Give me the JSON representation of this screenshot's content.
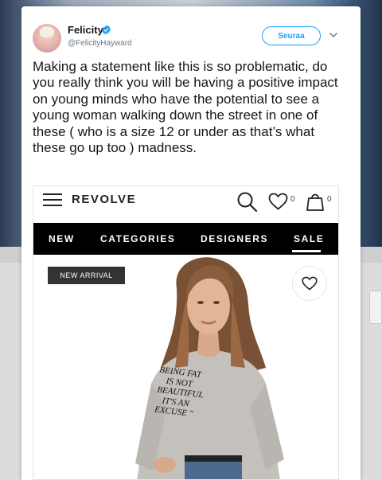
{
  "tweet": {
    "author_name": "Felicity",
    "handle": "@FelicityHayward",
    "follow_label": "Seuraa",
    "text": "Making a statement like this is so problematic, do you really think you will be having a positive impact on young minds who have the potential to see a young woman walking down the street in one of these ( who is a size 12 or under as that’s what these go up too ) madness."
  },
  "embedded": {
    "logo": "REVOLVE",
    "wishlist_count": "0",
    "bag_count": "0",
    "nav": [
      "NEW",
      "CATEGORIES",
      "DESIGNERS",
      "SALE"
    ],
    "badge": "NEW ARRIVAL",
    "shirt_lines": [
      "BEING FAT",
      "IS NOT",
      "BEAUTIFUL",
      "IT'S AN",
      "EXCUSE \""
    ]
  },
  "colors": {
    "accent": "#1da1f2",
    "nav_bg": "#000000",
    "badge_bg": "#333333"
  },
  "icons": [
    "verified-badge-icon",
    "chevron-down-icon",
    "menu-icon",
    "search-icon",
    "heart-icon",
    "shopping-bag-icon"
  ]
}
